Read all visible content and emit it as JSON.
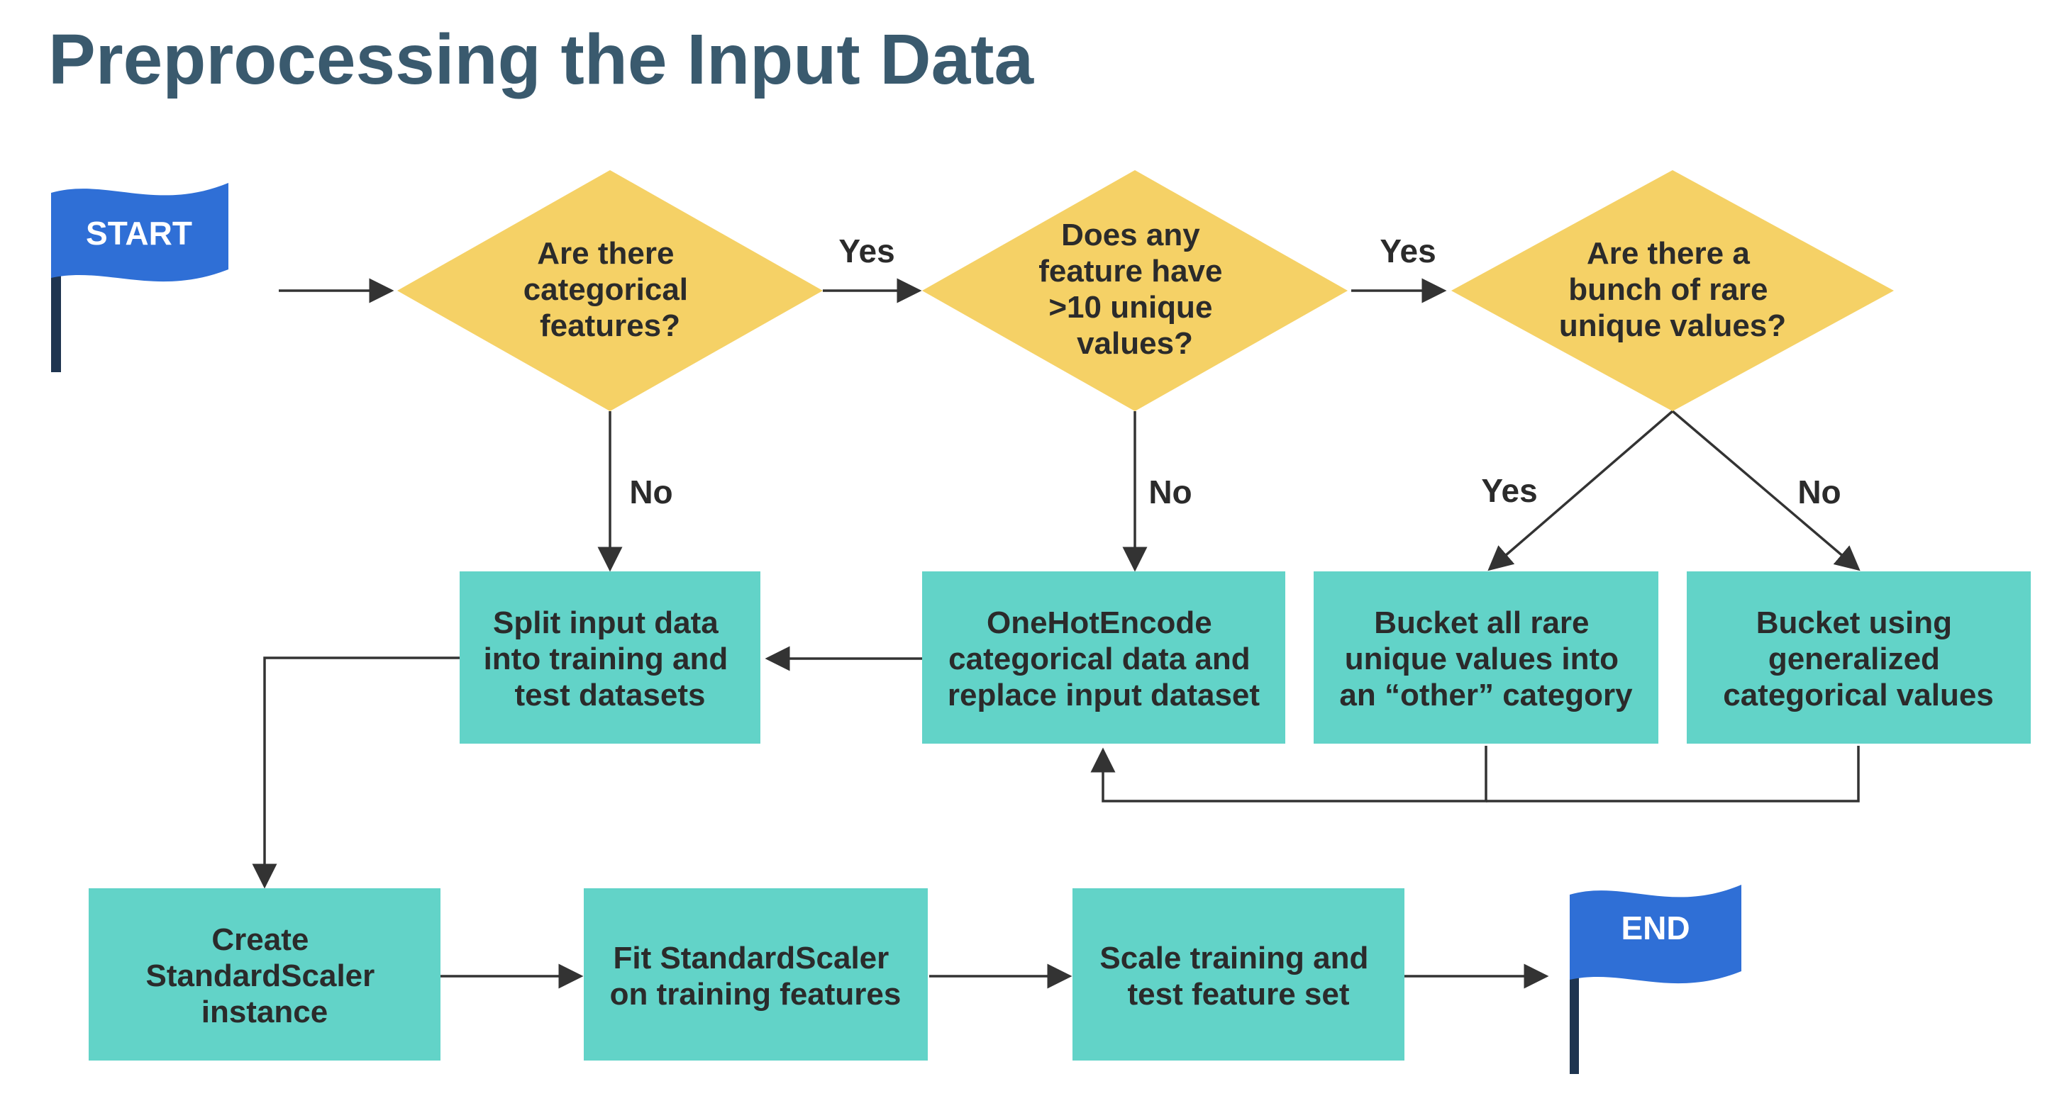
{
  "title": "Preprocessing the Input Data",
  "colors": {
    "title": "#3a5a6e",
    "decision_fill": "#f5d166",
    "process_fill": "#62d3c8",
    "flag_fill": "#2f6fd6",
    "flag_pole": "#1f3550",
    "edge": "#333333",
    "text": "#2b2b2b"
  },
  "start": {
    "label": "START",
    "icon": "flag-icon"
  },
  "end": {
    "label": "END",
    "icon": "flag-icon"
  },
  "decisions": {
    "categorical": [
      "Are there",
      "categorical",
      "features?"
    ],
    "unique": [
      "Does any",
      "feature have",
      ">10 unique",
      "values?"
    ],
    "rare": [
      "Are there a",
      "bunch of rare",
      "unique values?"
    ]
  },
  "processes": {
    "split": [
      "Split input data",
      "into training and",
      "test datasets"
    ],
    "onehot": [
      "OneHotEncode",
      "categorical data and",
      "replace input dataset"
    ],
    "bucket_rare": [
      "Bucket all rare",
      "unique values into",
      "an “other” category"
    ],
    "bucket_general": [
      "Bucket using",
      "generalized",
      "categorical values"
    ],
    "create_scaler": [
      "Create",
      "StandardScaler",
      "instance"
    ],
    "fit_scaler": [
      "Fit StandardScaler",
      "on training features"
    ],
    "scale_sets": [
      "Scale training and",
      "test feature set"
    ]
  },
  "edge_labels": {
    "categorical_yes": "Yes",
    "categorical_no": "No",
    "unique_yes": "Yes",
    "unique_no": "No",
    "rare_yes": "Yes",
    "rare_no": "No"
  }
}
